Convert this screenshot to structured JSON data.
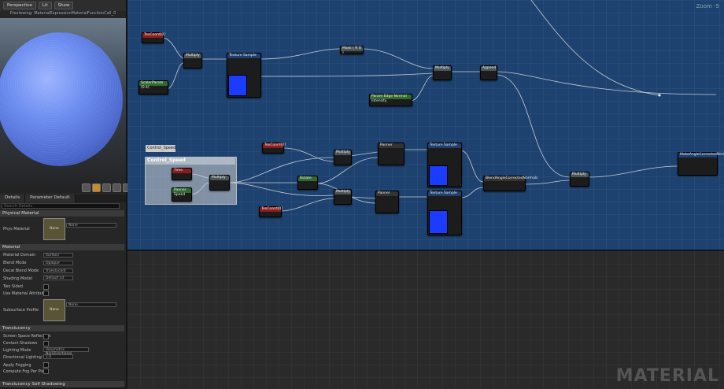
{
  "viewport": {
    "buttons": [
      "Perspective",
      "Lit",
      "Show"
    ],
    "title": "Previewing: MaterialExpressionMaterialFunctionCall_0"
  },
  "panel_tabs": [
    "Details",
    "Parameter Default"
  ],
  "search": {
    "placeholder": "Search Details"
  },
  "sections": {
    "physical": "Physical Material",
    "material": "Material",
    "translucency": "Translucency",
    "self_shadowing": "Translucency Self Shadowing"
  },
  "physical": {
    "label": "Phys Material",
    "swatch": "None",
    "value": "None"
  },
  "material_props": [
    {
      "label": "Material Domain",
      "value": "Surface"
    },
    {
      "label": "Blend Mode",
      "value": "Opaque"
    },
    {
      "label": "Decal Blend Mode",
      "value": "Translucent"
    },
    {
      "label": "Shading Model",
      "value": "Default Lit"
    },
    {
      "label": "Two Sided",
      "value": ""
    },
    {
      "label": "Use Material Attributes",
      "value": ""
    }
  ],
  "subsurface": {
    "label": "Subsurface Profile",
    "swatch": "None",
    "value": "None"
  },
  "translucency_props": [
    {
      "label": "Screen Space Reflection",
      "value": ""
    },
    {
      "label": "Contact Shadows",
      "value": ""
    },
    {
      "label": "Lighting Mode",
      "value": "Volumetric NonDirectional"
    },
    {
      "label": "Directional Lighting Inte",
      "value": "1.0"
    },
    {
      "label": "Apply Fogging",
      "value": ""
    },
    {
      "label": "Compute Fog Per Pixel",
      "value": ""
    }
  ],
  "graph": {
    "zoom": "Zoom -5",
    "watermark": "MATERIAL",
    "comment_tag": "Control_Speed",
    "comment_title": "Control_Speed"
  },
  "nodes": {
    "n1": "TexCoord[0]",
    "n2": "Multiply",
    "n3": "Texture Sample",
    "n4": "Mask ( R G )",
    "n5": "Multiply",
    "n6": "Append",
    "n7": "ScalarParam (0.4)",
    "n8": "Param Edge Normal Intensity",
    "n9": "Time",
    "n10": "Panner Speed",
    "n11": "Multiply",
    "n12": "TexCoord[0]",
    "n13": "Multiply",
    "n14": "Panner",
    "n15": "Texture Sample",
    "n16": "Multiply",
    "n17": "Rotate",
    "n18": "Panner",
    "n19": "Texture Sample",
    "n20": "BlendAngleCorrectedNormals",
    "n21": "Multiply",
    "n22": "MakeAngleCorrectedNormal",
    "n23": "TexCoord[0]"
  }
}
